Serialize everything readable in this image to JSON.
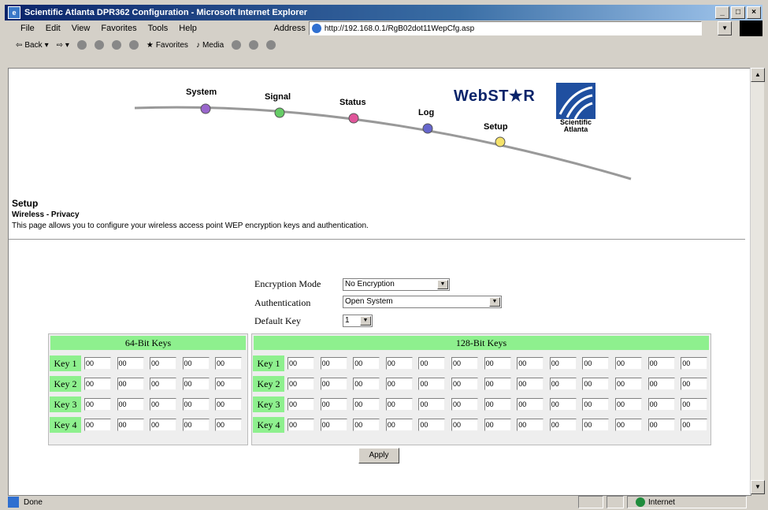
{
  "window": {
    "title": "Scientific Atlanta DPR362 Configuration - Microsoft Internet Explorer"
  },
  "menu": [
    "File",
    "Edit",
    "View",
    "Favorites",
    "Tools",
    "Help"
  ],
  "address": {
    "label": "Address",
    "url": "http://192.168.0.1/RgB02dot11WepCfg.asp"
  },
  "toolbar": {
    "back": "Back",
    "favorites": "Favorites",
    "media": "Media"
  },
  "nav": {
    "system": "System",
    "signal": "Signal",
    "status": "Status",
    "log": "Log",
    "setup": "Setup"
  },
  "brand": {
    "webstar": "WebST★R",
    "sa_line1": "Scientific",
    "sa_line2": "Atlanta"
  },
  "section": {
    "title": "Setup",
    "subtitle": "Wireless - Privacy",
    "description": "This page allows you to configure your wireless access point WEP encryption keys and authentication."
  },
  "form": {
    "encryption_label": "Encryption Mode",
    "encryption_value": "No Encryption",
    "auth_label": "Authentication",
    "auth_value": "Open System",
    "default_key_label": "Default Key",
    "default_key_value": "1"
  },
  "keys64": {
    "header": "64-Bit Keys",
    "rows": [
      {
        "label": "Key 1",
        "values": [
          "00",
          "00",
          "00",
          "00",
          "00"
        ]
      },
      {
        "label": "Key 2",
        "values": [
          "00",
          "00",
          "00",
          "00",
          "00"
        ]
      },
      {
        "label": "Key 3",
        "values": [
          "00",
          "00",
          "00",
          "00",
          "00"
        ]
      },
      {
        "label": "Key 4",
        "values": [
          "00",
          "00",
          "00",
          "00",
          "00"
        ]
      }
    ]
  },
  "keys128": {
    "header": "128-Bit Keys",
    "rows": [
      {
        "label": "Key 1",
        "values": [
          "00",
          "00",
          "00",
          "00",
          "00",
          "00",
          "00",
          "00",
          "00",
          "00",
          "00",
          "00",
          "00"
        ]
      },
      {
        "label": "Key 2",
        "values": [
          "00",
          "00",
          "00",
          "00",
          "00",
          "00",
          "00",
          "00",
          "00",
          "00",
          "00",
          "00",
          "00"
        ]
      },
      {
        "label": "Key 3",
        "values": [
          "00",
          "00",
          "00",
          "00",
          "00",
          "00",
          "00",
          "00",
          "00",
          "00",
          "00",
          "00",
          "00"
        ]
      },
      {
        "label": "Key 4",
        "values": [
          "00",
          "00",
          "00",
          "00",
          "00",
          "00",
          "00",
          "00",
          "00",
          "00",
          "00",
          "00",
          "00"
        ]
      }
    ]
  },
  "apply_label": "Apply",
  "status": {
    "text": "Done",
    "zone": "Internet"
  },
  "colors": {
    "key_green": "#8ef08e",
    "titlebar": "#0a246a"
  }
}
